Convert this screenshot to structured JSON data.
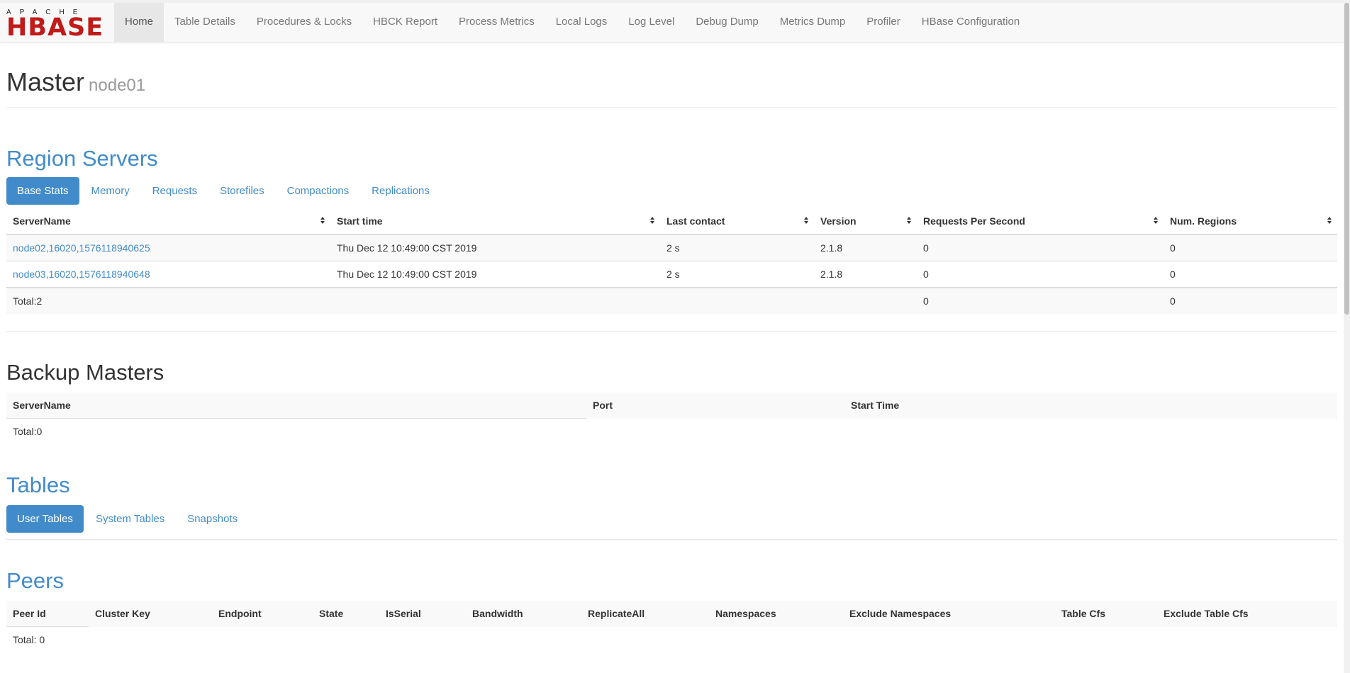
{
  "brand": {
    "top": "APACHE",
    "main": "HBASE"
  },
  "nav": [
    "Home",
    "Table Details",
    "Procedures & Locks",
    "HBCK Report",
    "Process Metrics",
    "Local Logs",
    "Log Level",
    "Debug Dump",
    "Metrics Dump",
    "Profiler",
    "HBase Configuration"
  ],
  "header": {
    "title": "Master",
    "host": "node01"
  },
  "region_servers": {
    "title": "Region Servers",
    "tabs": [
      "Base Stats",
      "Memory",
      "Requests",
      "Storefiles",
      "Compactions",
      "Replications"
    ],
    "columns": [
      "ServerName",
      "Start time",
      "Last contact",
      "Version",
      "Requests Per Second",
      "Num. Regions"
    ],
    "rows": [
      [
        "node02,16020,1576118940625",
        "Thu Dec 12 10:49:00 CST 2019",
        "2 s",
        "2.1.8",
        "0",
        "0"
      ],
      [
        "node03,16020,1576118940648",
        "Thu Dec 12 10:49:00 CST 2019",
        "2 s",
        "2.1.8",
        "0",
        "0"
      ]
    ],
    "total": {
      "label": "Total:2",
      "requests": "0",
      "regions": "0"
    }
  },
  "backup_masters": {
    "title": "Backup Masters",
    "columns": [
      "ServerName",
      "Port",
      "Start Time"
    ],
    "total": "Total:0"
  },
  "tables": {
    "title": "Tables",
    "tabs": [
      "User Tables",
      "System Tables",
      "Snapshots"
    ]
  },
  "peers": {
    "title": "Peers",
    "columns": [
      "Peer Id",
      "Cluster Key",
      "Endpoint",
      "State",
      "IsSerial",
      "Bandwidth",
      "ReplicateAll",
      "Namespaces",
      "Exclude Namespaces",
      "Table Cfs",
      "Exclude Table Cfs"
    ],
    "total": "Total: 0"
  }
}
